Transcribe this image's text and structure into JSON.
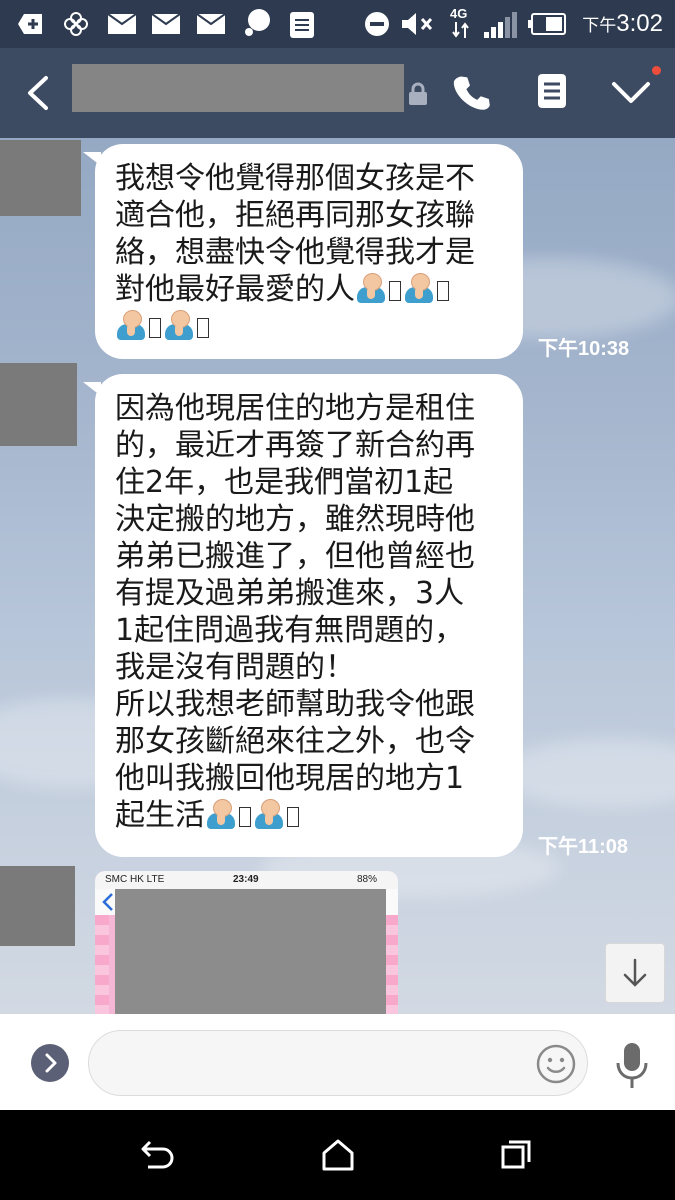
{
  "status_bar": {
    "network": "4G",
    "time_period": "下午",
    "time": "3:02",
    "icons": [
      "add-icon",
      "flower-app-icon",
      "mail-icon",
      "mail-icon",
      "mail-icon",
      "chat-bubble-icon",
      "document-icon",
      "do-not-disturb-icon",
      "mute-icon",
      "signal-icon",
      "battery-icon"
    ]
  },
  "header": {
    "back_icon": "chevron-left-icon",
    "call_icon": "phone-icon",
    "notes_icon": "notes-icon",
    "menu_icon": "chevron-down-icon",
    "lock_icon": "lock-icon",
    "notification_color": "#ef4d3b"
  },
  "messages": [
    {
      "text_lines": [
        "我想令他覺得那個女孩是不",
        "適合他，拒絕再同那女孩聯",
        "絡，想盡快令他覺得我才是",
        "對他最好最愛的人"
      ],
      "time": "下午10:38"
    },
    {
      "text_lines": [
        "因為他現居住的地方是租住",
        "的，最近才再簽了新合約再",
        "住2年，也是我們當初1起",
        "決定搬的地方，雖然現時他",
        "弟弟已搬進了，但他曾經也",
        "有提及過弟弟搬進來，3人",
        "1起住問過我有無問題的，",
        "我是沒有問題的！",
        "所以我想老師幫助我令他跟",
        "那女孩斷絕來往之外，也令",
        "他叫我搬回他現居的地方1",
        "起生活"
      ],
      "time": "下午11:08"
    }
  ],
  "shared_image": {
    "carrier": "SMC HK  LTE",
    "time": "23:49",
    "battery": "88%"
  },
  "input": {
    "placeholder": "",
    "expand_icon": "chevron-right-icon",
    "emoji_icon": "smiley-icon",
    "mic_icon": "microphone-icon"
  },
  "nav": [
    "back-icon",
    "home-icon",
    "recents-icon"
  ],
  "colors": {
    "header": "#3c4a62",
    "status_bar": "#2d3a4f",
    "timestamp": "#ffffff"
  }
}
